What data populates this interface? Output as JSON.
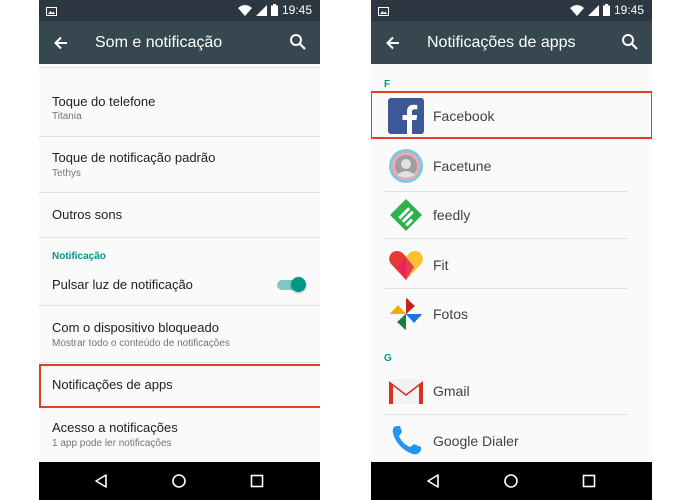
{
  "status_bar": {
    "time": "19:45"
  },
  "left_screen": {
    "title": "Som e notificação",
    "items": [
      {
        "title": "Toque do telefone",
        "subtitle": "Titania"
      },
      {
        "title": "Toque de notificação padrão",
        "subtitle": "Tethys"
      },
      {
        "title": "Outros sons"
      },
      {
        "category": "Notificação"
      },
      {
        "title": "Pulsar luz de notificação",
        "toggle_on": true
      },
      {
        "title": "Com o dispositivo bloqueado",
        "subtitle": "Mostrar todo o conteúdo de notificações"
      },
      {
        "title": "Notificações de apps",
        "highlighted": true
      },
      {
        "title": "Acesso a notificações",
        "subtitle": "1 app pode ler notificações"
      }
    ]
  },
  "right_screen": {
    "title": "Notificações de apps",
    "sections": [
      {
        "letter": "F",
        "apps": [
          "Facebook",
          "Facetune",
          "feedly",
          "Fit",
          "Fotos"
        ]
      },
      {
        "letter": "G",
        "apps": [
          "Gmail",
          "Google Dialer"
        ]
      }
    ],
    "highlighted_app": "Facebook"
  },
  "colors": {
    "status_bar": "#2d3741",
    "app_bar": "#37474f",
    "accent_teal": "#009688",
    "highlight_red": "#e1401f"
  },
  "icons": [
    "back-arrow-icon",
    "search-icon",
    "nav-back-icon",
    "nav-home-icon",
    "nav-recents-icon"
  ]
}
